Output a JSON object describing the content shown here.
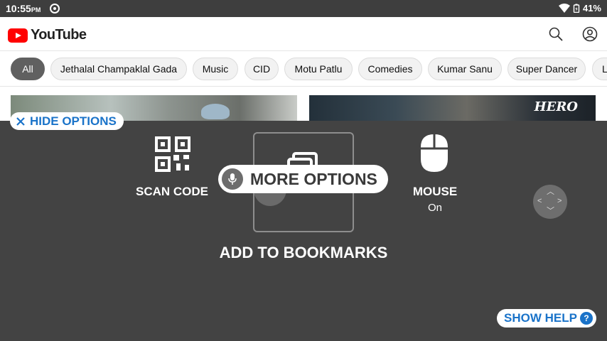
{
  "status_bar": {
    "time": "10:55",
    "ampm": "PM",
    "battery": "41%"
  },
  "header": {
    "app_name": "YouTube",
    "icons": [
      "search-icon",
      "account-icon"
    ]
  },
  "chips": [
    {
      "label": "All",
      "active": true
    },
    {
      "label": "Jethalal Champaklal Gada",
      "active": false
    },
    {
      "label": "Music",
      "active": false
    },
    {
      "label": "CID",
      "active": false
    },
    {
      "label": "Motu Patlu",
      "active": false
    },
    {
      "label": "Comedies",
      "active": false
    },
    {
      "label": "Kumar Sanu",
      "active": false
    },
    {
      "label": "Super Dancer",
      "active": false
    },
    {
      "label": "L",
      "active": false
    }
  ],
  "feed": {
    "thumb2_overlay_text": "HERO"
  },
  "overlay": {
    "hide_options": "HIDE OPTIONS",
    "scan_code": "SCAN CODE",
    "more_options": "MORE OPTIONS",
    "add_to_bookmarks": "ADD TO BOOKMARKS",
    "mouse": "MOUSE",
    "mouse_state": "On",
    "show_help": "SHOW HELP",
    "help_glyph": "?"
  },
  "colors": {
    "overlay_bg": "#434343",
    "accent_blue": "#1a73c9",
    "youtube_red": "#ff0000"
  }
}
